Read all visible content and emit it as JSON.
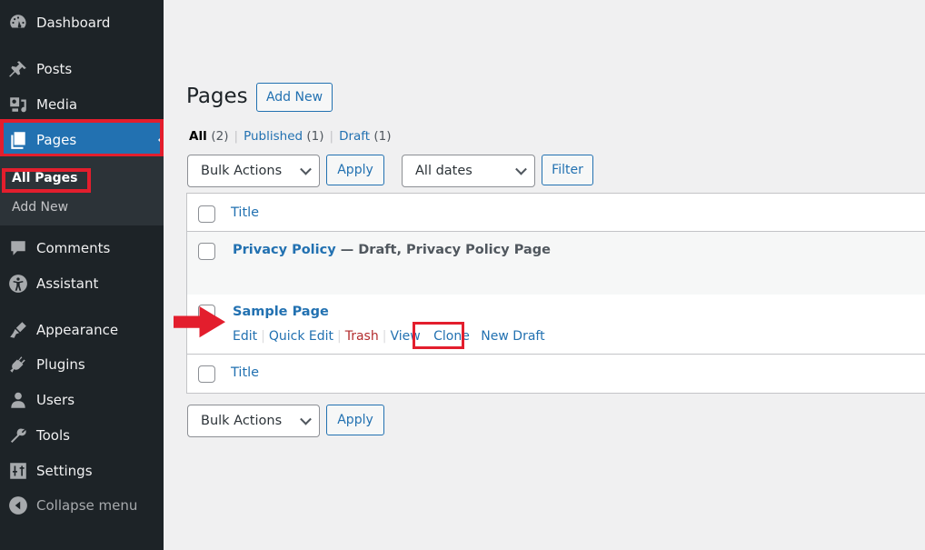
{
  "sidebar": {
    "items": [
      {
        "label": "Dashboard",
        "icon": "dashboard-icon"
      },
      {
        "label": "Posts",
        "icon": "pin-icon"
      },
      {
        "label": "Media",
        "icon": "media-icon"
      },
      {
        "label": "Pages",
        "icon": "pages-icon",
        "active": true
      },
      {
        "label": "Comments",
        "icon": "comment-icon"
      },
      {
        "label": "Assistant",
        "icon": "accessibility-icon"
      },
      {
        "label": "Appearance",
        "icon": "paintbrush-icon"
      },
      {
        "label": "Plugins",
        "icon": "plug-icon"
      },
      {
        "label": "Users",
        "icon": "user-icon"
      },
      {
        "label": "Tools",
        "icon": "wrench-icon"
      },
      {
        "label": "Settings",
        "icon": "settings-sliders-icon"
      }
    ],
    "submenu": [
      {
        "label": "All Pages",
        "current": true
      },
      {
        "label": "Add New"
      }
    ],
    "collapse_label": "Collapse menu"
  },
  "header": {
    "title": "Pages",
    "add_new_label": "Add New"
  },
  "filters": {
    "views": [
      {
        "label": "All",
        "count": "(2)",
        "current": true
      },
      {
        "label": "Published",
        "count": "(1)"
      },
      {
        "label": "Draft",
        "count": "(1)"
      }
    ],
    "bulk_actions_selected": "Bulk Actions",
    "apply_label": "Apply",
    "dates_selected": "All dates",
    "filter_label": "Filter"
  },
  "table": {
    "column_title": "Title",
    "rows": [
      {
        "title": "Privacy Policy",
        "state": " — Draft, Privacy Policy Page"
      },
      {
        "title": "Sample Page",
        "state": ""
      }
    ],
    "row_actions": [
      "Edit",
      "Quick Edit",
      "Trash",
      "View",
      "Clone",
      "New Draft"
    ]
  },
  "colors": {
    "accent": "#2271b1",
    "sidebar_bg": "#1d2327",
    "highlight": "#e31e2d",
    "trash": "#b32d2e"
  }
}
